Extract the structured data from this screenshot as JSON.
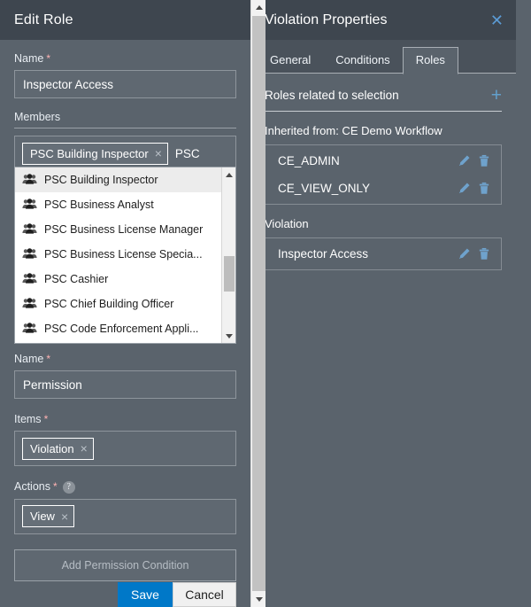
{
  "left_panel": {
    "title": "Edit Role",
    "name_label": "Name",
    "required_mark": "*",
    "name_value": "Inspector Access",
    "members_label": "Members",
    "member_chip": "PSC Building Inspector",
    "member_chip_remove": "×",
    "member_typed_text": "PSC",
    "dropdown": {
      "items": [
        {
          "label": "PSC Building Inspector",
          "icon": "people-icon",
          "selected": true
        },
        {
          "label": "PSC Business Analyst",
          "icon": "people-icon",
          "selected": false
        },
        {
          "label": "PSC Business License Manager",
          "icon": "people-icon",
          "selected": false
        },
        {
          "label": "PSC Business License Specia...",
          "icon": "people-icon",
          "selected": false
        },
        {
          "label": "PSC Cashier",
          "icon": "people-icon",
          "selected": false
        },
        {
          "label": "PSC Chief Building Officer",
          "icon": "people-icon",
          "selected": false
        },
        {
          "label": "PSC Code Enforcement Appli...",
          "icon": "people-icon",
          "selected": false
        }
      ],
      "scroll_up_icon": "triangle-up-icon",
      "scroll_down_icon": "triangle-down-icon"
    },
    "permission": {
      "name_label": "Name",
      "name_value": "Permission",
      "items_label": "Items",
      "items_chip": "Violation",
      "items_chip_remove": "×",
      "actions_label": "Actions",
      "actions_help_icon": "?",
      "actions_chip": "View",
      "actions_chip_remove": "×",
      "add_condition_label": "Add Permission Condition"
    },
    "save_label": "Save",
    "cancel_label": "Cancel",
    "scrollbar": {
      "up_icon": "triangle-up-icon",
      "down_icon": "triangle-down-icon"
    }
  },
  "right_panel": {
    "title": "Violation Properties",
    "close_icon": "✕",
    "tabs": [
      {
        "label": "General",
        "active": false
      },
      {
        "label": "Conditions",
        "active": false
      },
      {
        "label": "Roles",
        "active": true
      }
    ],
    "roles_section_title": "Roles related to selection",
    "add_icon": "+",
    "groups": [
      {
        "label": "Inherited from: CE Demo Workflow",
        "roles": [
          {
            "name": "CE_ADMIN"
          },
          {
            "name": "CE_VIEW_ONLY"
          }
        ]
      },
      {
        "label": "Violation",
        "roles": [
          {
            "name": "Inspector Access"
          }
        ]
      }
    ]
  },
  "colors": {
    "panel_bg": "#5a636c",
    "header_bg": "#3e464f",
    "accent_blue": "#0078c8",
    "icon_blue": "#62a0cc",
    "field_bg": "#5f6871",
    "border": "#8e959c"
  }
}
